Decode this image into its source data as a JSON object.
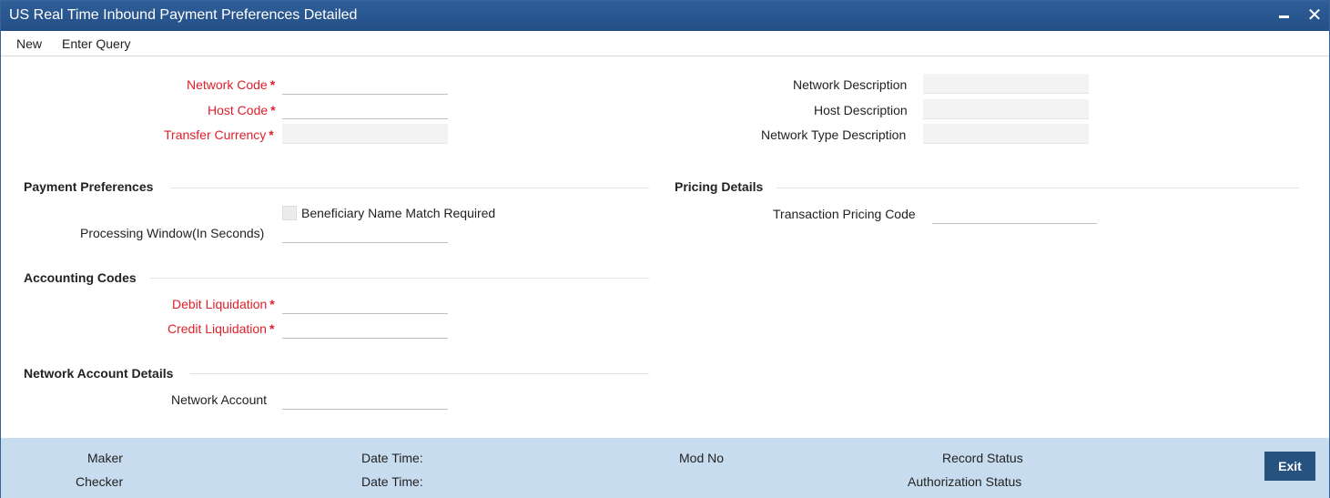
{
  "window": {
    "title": "US Real Time Inbound Payment Preferences Detailed",
    "minimize_icon": "minimize-icon",
    "close_icon": "close-icon",
    "close_glyph": "✕"
  },
  "toolbar": {
    "new_label": "New",
    "enter_query_label": "Enter Query"
  },
  "required_marker": "*",
  "header_fields": {
    "network_code": {
      "label": "Network Code",
      "value": ""
    },
    "host_code": {
      "label": "Host Code",
      "value": ""
    },
    "transfer_currency": {
      "label": "Transfer Currency",
      "value": ""
    },
    "network_description": {
      "label": "Network Description",
      "value": ""
    },
    "host_description": {
      "label": "Host Description",
      "value": ""
    },
    "network_type_description": {
      "label": "Network Type Description",
      "value": ""
    }
  },
  "payment_preferences": {
    "title": "Payment Preferences",
    "beneficiary_name_match": {
      "label": "Beneficiary Name Match Required",
      "checked": false
    },
    "processing_window": {
      "label": "Processing Window(In Seconds)",
      "value": ""
    }
  },
  "pricing_details": {
    "title": "Pricing Details",
    "transaction_pricing_code": {
      "label": "Transaction Pricing Code",
      "value": ""
    }
  },
  "accounting_codes": {
    "title": "Accounting Codes",
    "debit_liquidation": {
      "label": "Debit Liquidation",
      "value": ""
    },
    "credit_liquidation": {
      "label": "Credit Liquidation",
      "value": ""
    }
  },
  "network_account_details": {
    "title": "Network Account Details",
    "network_account": {
      "label": "Network Account",
      "value": ""
    }
  },
  "footer": {
    "maker": "Maker",
    "checker": "Checker",
    "date_time_1": "Date Time:",
    "date_time_2": "Date Time:",
    "mod_no": "Mod No",
    "record_status": "Record Status",
    "authorization_status": "Authorization Status",
    "exit_label": "Exit"
  },
  "colors": {
    "titlebar": "#2a5890",
    "required_label": "#e0202b",
    "footer_bg": "#c7dcee",
    "exit_button": "#25527f"
  }
}
